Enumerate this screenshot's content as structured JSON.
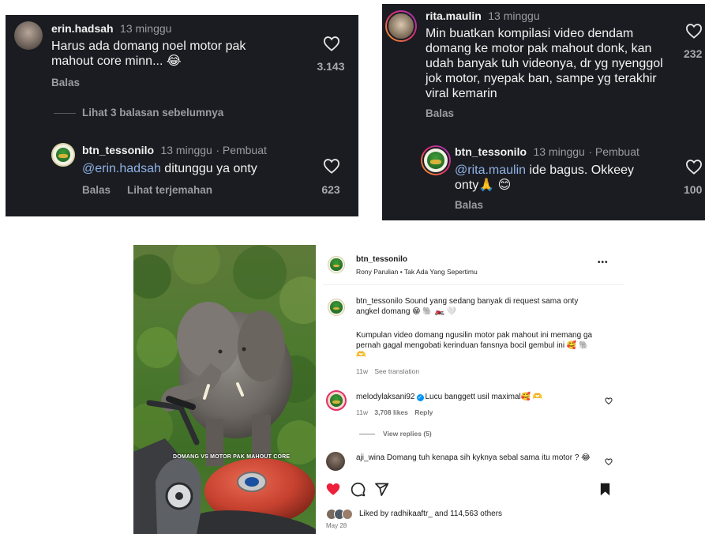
{
  "left_panel": {
    "comment": {
      "username": "erin.hadsah",
      "time": "13 minggu",
      "text": "Harus ada domang noel motor pak mahout core minn... 😂",
      "reply_label": "Balas",
      "like_count": "3.143"
    },
    "view_replies": "Lihat 3 balasan sebelumnya",
    "reply": {
      "username": "btn_tessonilo",
      "time": "13 minggu",
      "creator_badge": "· Pembuat",
      "mention": "@erin.hadsah",
      "text": " ditunggu ya onty",
      "reply_label": "Balas",
      "translate_label": "Lihat terjemahan",
      "like_count": "623"
    }
  },
  "right_panel": {
    "comment": {
      "username": "rita.maulin",
      "time": "13 minggu",
      "text": "Min buatkan kompilasi video dendam domang ke motor pak mahout donk, kan udah banyak tuh videonya, dr yg nyenggol jok motor, nyepak ban, sampe yg terakhir viral kemarin",
      "reply_label": "Balas",
      "like_count": "232"
    },
    "reply": {
      "username": "btn_tessonilo",
      "time": "13 minggu",
      "creator_badge": "· Pembuat",
      "mention": "@rita.maulin",
      "text": " ide bagus. Okkeey onty🙏 😊",
      "reply_label": "Balas",
      "like_count": "100"
    }
  },
  "post": {
    "photo_caption": "DOMANG VS MOTOR PAK MAHOUT CORE",
    "header": {
      "username": "btn_tessonilo",
      "audio": "Rony Parulian • Tak Ada Yang Sepertimu",
      "more": "•••"
    },
    "caption": {
      "username": "btn_tessonilo",
      "text1": "Sound yang sedang banyak di request sama onty angkel domang 😁 🐘 🏍️ 🤍",
      "text2": "Kumpulan video domang ngusilin motor pak mahout ini memang ga pernah gagal mengobati kerinduan fansnya bocil gembul ini 🥰 🐘 🫶",
      "age": "11w",
      "translate": "See translation"
    },
    "comments": [
      {
        "username": "melodylaksani92",
        "text": "Lucu banggett usil maximal🥰 🫶",
        "age": "11w",
        "likes": "3,708 likes",
        "reply": "Reply",
        "view_replies": "View replies (5)"
      },
      {
        "username": "aji_wina",
        "text": "Domang tuh kenapa sih kyknya sebal sama itu motor ? 😂"
      }
    ],
    "liked_by_prefix": "Liked by ",
    "liked_by_user": "radhikaaftr_",
    "liked_by_suffix": " and 114,563 others",
    "date": "May 28"
  },
  "icons": {
    "like": "heart-icon",
    "comment": "comment-icon",
    "share": "send-icon",
    "save": "bookmark-icon",
    "more": "more-icon"
  },
  "colors": {
    "dark_bg": "#1b1c21",
    "mention": "#8fb3e8",
    "liked_heart": "#ed1f3a",
    "verified": "#0095f6"
  }
}
